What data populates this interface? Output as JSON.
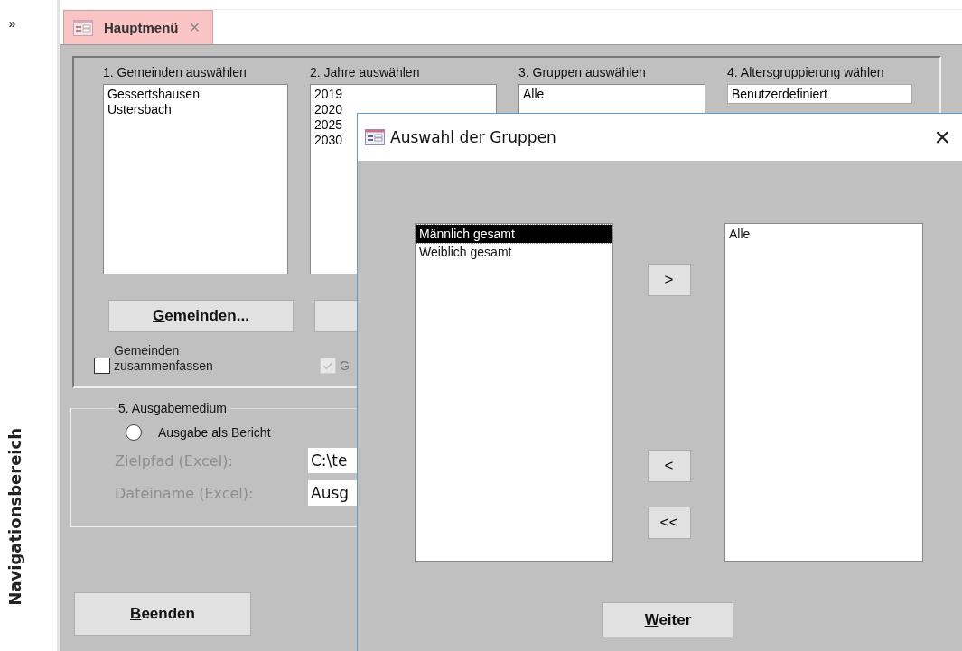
{
  "nav": {
    "toggle": "»",
    "label": "Navigationsbereich"
  },
  "tabs": [
    {
      "label": "Hauptmenü",
      "selected": true,
      "close": "×"
    }
  ],
  "form": {
    "columns": [
      {
        "heading": "1. Gemeinden auswählen",
        "kind": "list",
        "items": [
          "Gessertshausen",
          "Ustersbach"
        ]
      },
      {
        "heading": "2. Jahre auswählen",
        "kind": "list",
        "items": [
          "2019",
          "2020",
          "2025",
          "2030"
        ]
      },
      {
        "heading": "3. Gruppen auswählen",
        "kind": "list",
        "items": [
          "Alle"
        ]
      },
      {
        "heading": "4. Altersgruppierung wählen",
        "kind": "combo",
        "items": [
          "Benutzerdefiniert"
        ]
      }
    ],
    "button": "Gemeinden...",
    "checkboxes": [
      {
        "label": "Gemeinden zusammenfassen",
        "checked": false,
        "disabled": false
      },
      {
        "label": "G",
        "checked": true,
        "disabled": true
      }
    ],
    "output": {
      "legend": "5. Ausgabemedium",
      "radio": {
        "label": "Ausgabe als Bericht",
        "selected": false
      },
      "fields": [
        {
          "label": "Zielpfad (Excel):",
          "value": "C:\\te"
        },
        {
          "label": "Dateiname (Excel):",
          "value": "Ausg"
        }
      ]
    },
    "exit_button": "Beenden"
  },
  "dialog": {
    "title": "Auswahl der Gruppen",
    "close": "×",
    "available": [
      {
        "label": "Männlich gesamt",
        "selected": true
      },
      {
        "label": "Weiblich gesamt",
        "selected": false
      }
    ],
    "move_buttons": [
      ">",
      "<",
      "<<"
    ],
    "chosen": [
      {
        "label": "Alle",
        "selected": false
      }
    ],
    "next_button": "Weiter"
  }
}
